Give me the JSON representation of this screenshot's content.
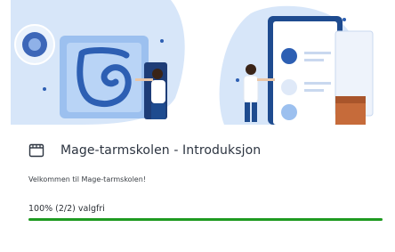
{
  "course": {
    "title": "Mage-tarmskolen - Introduksjon",
    "description": "Velkommen til Mage-tarmskolen!",
    "progress_label": "100% (2/2) valgfri",
    "progress_fraction": 1.0,
    "icon": "course-module-icon"
  },
  "colors": {
    "progress": "#1f9a21",
    "banner_blue": "#cfe0f7",
    "banner_dark": "#1e4b8f"
  }
}
